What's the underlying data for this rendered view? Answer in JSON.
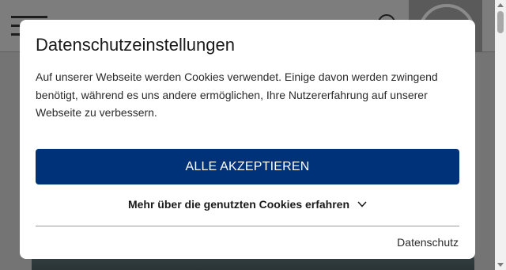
{
  "modal": {
    "title": "Datenschutzeinstellungen",
    "body": "Auf unserer Webseite werden Cookies verwendet. Einige davon werden zwingend benötigt, während es uns andere ermöglichen, Ihre Nutzererfahrung auf unserer Webseite zu verbessern.",
    "accept_label": "ALLE AKZEPTIEREN",
    "more_label": "Mehr über die genutzten Cookies erfahren",
    "more_icon": "chevron-down-icon",
    "privacy_label": "Datenschutz"
  },
  "header": {
    "menu_icon": "hamburger-menu-icon",
    "search_icon": "search-icon"
  },
  "colors": {
    "accent": "#00327a",
    "overlay": "#7a7a7a",
    "modal_bg": "#ffffff"
  }
}
